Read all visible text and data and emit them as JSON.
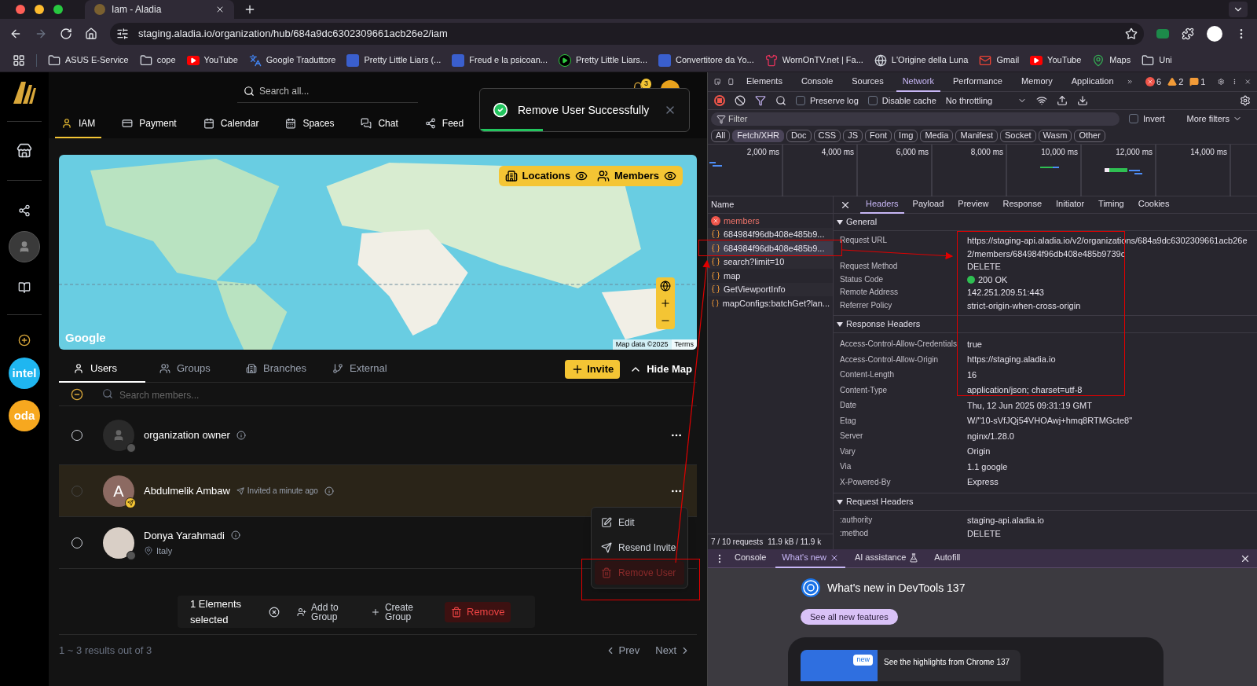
{
  "browser": {
    "tab_title": "Iam - Aladia",
    "address": "staging.aladia.io/organization/hub/684a9dc6302309661acb26e2/iam",
    "bookmarks": [
      {
        "label": "ASUS E-Service",
        "kind": "folder"
      },
      {
        "label": "cope",
        "kind": "folder"
      },
      {
        "label": "YouTube",
        "kind": "video"
      },
      {
        "label": "Google Traduttore",
        "kind": "translate"
      },
      {
        "label": "Pretty Little Liars (...",
        "kind": "site"
      },
      {
        "label": "Freud e la psicoan...",
        "kind": "site"
      },
      {
        "label": "Pretty Little Liars...",
        "kind": "play"
      },
      {
        "label": "Convertitore da Yo...",
        "kind": "site"
      },
      {
        "label": "WornOnTV.net | Fa...",
        "kind": "dress"
      },
      {
        "label": "L'Origine della Luna",
        "kind": "globe"
      },
      {
        "label": "Gmail",
        "kind": "mail"
      },
      {
        "label": "YouTube",
        "kind": "video"
      },
      {
        "label": "Maps",
        "kind": "pin"
      },
      {
        "label": "Uni",
        "kind": "folder"
      }
    ]
  },
  "app": {
    "orgs": [
      {
        "label": "intel",
        "color": "#1fb6f0"
      },
      {
        "label": "oda",
        "color": "#f7a81f"
      }
    ],
    "search": {
      "placeholder": "Search all..."
    },
    "notification_count": "3",
    "nav": [
      {
        "label": "IAM",
        "kind": "user",
        "selected": true
      },
      {
        "label": "Payment",
        "kind": "card",
        "selected": false
      },
      {
        "label": "Calendar",
        "kind": "calendar",
        "selected": false
      },
      {
        "label": "Spaces",
        "kind": "spaces",
        "selected": false
      },
      {
        "label": "Chat",
        "kind": "chat",
        "selected": false
      },
      {
        "label": "Feed",
        "kind": "share",
        "selected": false
      }
    ],
    "toast": {
      "message": "Remove User Successfully",
      "level": 0.3
    },
    "map": {
      "layers": [
        {
          "label": "Locations",
          "kind": "building",
          "visible": true
        },
        {
          "label": "Members",
          "kind": "users",
          "visible": true
        }
      ],
      "logo": "Google",
      "attribution": "Map data ©2025",
      "terms": "Terms"
    },
    "member_tabs": [
      {
        "label": "Users",
        "kind": "user",
        "selected": true
      },
      {
        "label": "Groups",
        "kind": "users",
        "selected": false
      },
      {
        "label": "Branches",
        "kind": "building",
        "selected": false
      },
      {
        "label": "External",
        "kind": "branch",
        "selected": false
      }
    ],
    "invite_button": "Invite",
    "hide_map_button": "Hide Map",
    "member_search": {
      "placeholder": "Search members..."
    },
    "members": [
      {
        "name": "organization owner",
        "kind": "placeholder",
        "checked": false,
        "disabled": false,
        "selected": false
      },
      {
        "name": "Abdulmelik Ambaw",
        "kind": "letter",
        "initial": "A",
        "note": "Invited a minute ago",
        "checked": false,
        "disabled": true,
        "selected": true
      },
      {
        "name": "Donya Yarahmadi",
        "kind": "photo",
        "location": "Italy",
        "checked": false,
        "disabled": false,
        "selected": false
      }
    ],
    "row_menu": [
      {
        "label": "Edit",
        "kind": "edit",
        "selected": false
      },
      {
        "label": "Resend Invite",
        "kind": "send",
        "selected": false
      },
      {
        "label": "Remove User",
        "kind": "danger",
        "selected": true
      }
    ],
    "bulk_bar": {
      "count": "1 Elements selected",
      "actions": [
        {
          "label": "Add to Group",
          "kind": "add_user"
        },
        {
          "label": "Create Group",
          "kind": "plus"
        },
        {
          "label": "Remove",
          "kind": "danger"
        }
      ]
    },
    "pagination": {
      "summary": "1 ~ 3 results out of 3",
      "prev": "Prev",
      "next": "Next"
    }
  },
  "devtools": {
    "panels": [
      {
        "label": "Elements",
        "selected": false
      },
      {
        "label": "Console",
        "selected": false
      },
      {
        "label": "Sources",
        "selected": false
      },
      {
        "label": "Network",
        "selected": true
      },
      {
        "label": "Performance",
        "selected": false
      },
      {
        "label": "Memory",
        "selected": false
      },
      {
        "label": "Application",
        "selected": false
      }
    ],
    "counts": [
      {
        "kind": "error",
        "value": "6"
      },
      {
        "kind": "warning",
        "value": "2"
      },
      {
        "kind": "info",
        "value": "1"
      }
    ],
    "preserve_log": {
      "label": "Preserve log",
      "checked": false
    },
    "disable_cache": {
      "label": "Disable cache",
      "checked": false
    },
    "throttling": "No throttling",
    "filter": {
      "placeholder": "Filter"
    },
    "invert": {
      "label": "Invert",
      "checked": false
    },
    "more_filters": "More filters",
    "types": [
      {
        "label": "All",
        "selected": false
      },
      {
        "label": "Fetch/XHR",
        "selected": true
      },
      {
        "label": "Doc",
        "selected": false
      },
      {
        "label": "CSS",
        "selected": false
      },
      {
        "label": "JS",
        "selected": false
      },
      {
        "label": "Font",
        "selected": false
      },
      {
        "label": "Img",
        "selected": false
      },
      {
        "label": "Media",
        "selected": false
      },
      {
        "label": "Manifest",
        "selected": false
      },
      {
        "label": "Socket",
        "selected": false
      },
      {
        "label": "Wasm",
        "selected": false
      },
      {
        "label": "Other",
        "selected": false
      }
    ],
    "timeline_ticks": [
      "2,000 ms",
      "4,000 ms",
      "6,000 ms",
      "8,000 ms",
      "10,000 ms",
      "12,000 ms",
      "14,000 ms"
    ],
    "name_header": "Name",
    "requests": [
      {
        "name": "members",
        "kind": "error",
        "selected": false
      },
      {
        "name": "684984f96db408e485b9...",
        "kind": "fetch",
        "selected": false
      },
      {
        "name": "684984f96db408e485b9...",
        "kind": "fetch",
        "selected": true
      },
      {
        "name": "search?limit=10",
        "kind": "fetch",
        "selected": false
      },
      {
        "name": "map",
        "kind": "fetch",
        "selected": false
      },
      {
        "name": "GetViewportInfo",
        "kind": "fetch",
        "selected": false
      },
      {
        "name": "mapConfigs:batchGet?lan...",
        "kind": "fetch",
        "selected": false
      }
    ],
    "summary": [
      "7 / 10 requests",
      "11.9 kB / 11.9 k"
    ],
    "detail_tabs": [
      {
        "label": "Headers",
        "selected": true
      },
      {
        "label": "Payload",
        "selected": false
      },
      {
        "label": "Preview",
        "selected": false
      },
      {
        "label": "Response",
        "selected": false
      },
      {
        "label": "Initiator",
        "selected": false
      },
      {
        "label": "Timing",
        "selected": false
      },
      {
        "label": "Cookies",
        "selected": false
      }
    ],
    "sections": [
      {
        "title": "General",
        "expanded": true,
        "rows": [
          {
            "key": "Request URL",
            "value": "https://staging-api.aladia.io/v2/organizations/684a9dc6302309661acb26e2/members/684984f96db408e485b9739c",
            "kind": "text"
          },
          {
            "key": "Request Method",
            "value": "DELETE",
            "kind": "text"
          },
          {
            "key": "Status Code",
            "value": "200 OK",
            "kind": "status"
          },
          {
            "key": "Remote Address",
            "value": "142.251.209.51:443",
            "kind": "text"
          },
          {
            "key": "Referrer Policy",
            "value": "strict-origin-when-cross-origin",
            "kind": "text"
          }
        ]
      },
      {
        "title": "Response Headers",
        "expanded": true,
        "rows": [
          {
            "key": "Access-Control-Allow-Credentials",
            "value": "true",
            "kind": "text"
          },
          {
            "key": "Access-Control-Allow-Origin",
            "value": "https://staging.aladia.io",
            "kind": "text"
          },
          {
            "key": "Content-Length",
            "value": "16",
            "kind": "text"
          },
          {
            "key": "Content-Type",
            "value": "application/json; charset=utf-8",
            "kind": "text"
          },
          {
            "key": "Date",
            "value": "Thu, 12 Jun 2025 09:31:19 GMT",
            "kind": "text"
          },
          {
            "key": "Etag",
            "value": "W/\"10-sVfJQj54VHOAwj+hmq8RTMGcte8\"",
            "kind": "text"
          },
          {
            "key": "Server",
            "value": "nginx/1.28.0",
            "kind": "text"
          },
          {
            "key": "Vary",
            "value": "Origin",
            "kind": "text"
          },
          {
            "key": "Via",
            "value": "1.1 google",
            "kind": "text"
          },
          {
            "key": "X-Powered-By",
            "value": "Express",
            "kind": "text"
          }
        ]
      },
      {
        "title": "Request Headers",
        "expanded": true,
        "rows": [
          {
            "key": ":authority",
            "value": "staging-api.aladia.io",
            "kind": "text"
          },
          {
            "key": ":method",
            "value": "DELETE",
            "kind": "text"
          }
        ]
      }
    ],
    "drawer": {
      "tabs": [
        {
          "label": "Console",
          "selected": false,
          "closable": false,
          "kind": "plain"
        },
        {
          "label": "What's new",
          "selected": true,
          "closable": true,
          "kind": "plain"
        },
        {
          "label": "AI assistance",
          "selected": false,
          "closable": false,
          "kind": "experimental"
        },
        {
          "label": "Autofill",
          "selected": false,
          "closable": false,
          "kind": "plain"
        }
      ],
      "title": "What's new in DevTools 137",
      "button": "See all new features",
      "card_badge": "new",
      "card_text": "See the highlights from Chrome 137"
    }
  }
}
